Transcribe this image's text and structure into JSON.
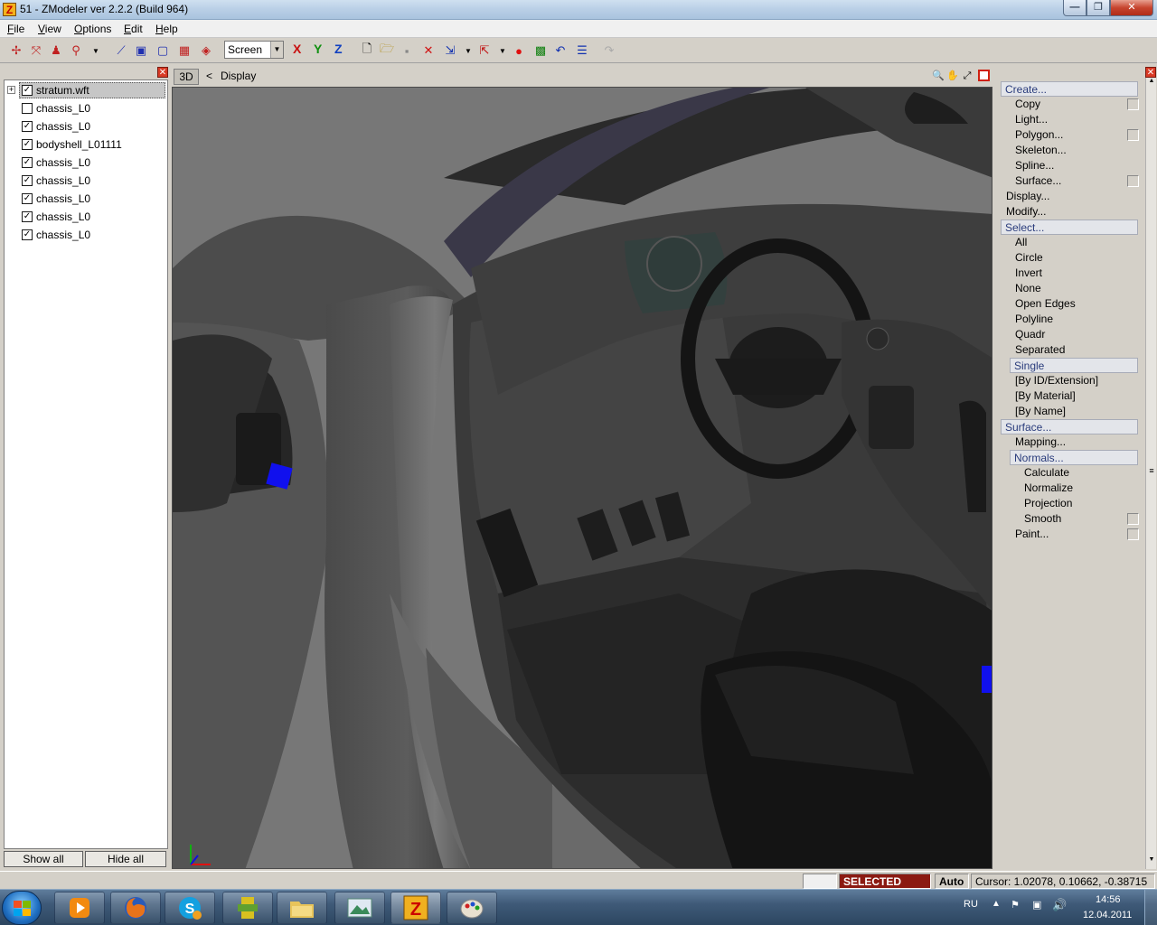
{
  "window": {
    "title": "51 - ZModeler ver 2.2.2 (Build 964)",
    "icon": "Z"
  },
  "menu": [
    {
      "label": "File",
      "key": "F",
      "rest": "ile"
    },
    {
      "label": "View",
      "key": "V",
      "rest": "iew"
    },
    {
      "label": "Options",
      "key": "O",
      "rest": "ptions"
    },
    {
      "label": "Edit",
      "key": "E",
      "rest": "dit"
    },
    {
      "label": "Help",
      "key": "H",
      "rest": "elp"
    }
  ],
  "toolbar": {
    "coord_mode": "Screen",
    "axes": [
      "X",
      "Y",
      "Z"
    ],
    "axis_colors": [
      "#c81010",
      "#109010",
      "#1040c0"
    ]
  },
  "tree": {
    "items": [
      {
        "label": "stratum.wft",
        "checked": "✓",
        "expandable": "+"
      },
      {
        "label": "chassis_L0",
        "checked": ""
      },
      {
        "label": "chassis_L0",
        "checked": "✓"
      },
      {
        "label": "bodyshell_L01111",
        "checked": "✓"
      },
      {
        "label": "chassis_L0",
        "checked": "✓"
      },
      {
        "label": "chassis_L0",
        "checked": "✓"
      },
      {
        "label": "chassis_L0",
        "checked": "✓"
      },
      {
        "label": "chassis_L0",
        "checked": "✓"
      },
      {
        "label": "chassis_L0",
        "checked": "✓"
      }
    ],
    "show_all": "Show all",
    "hide_all": "Hide all"
  },
  "viewport": {
    "mode": "3D",
    "back": "<",
    "title": "Display"
  },
  "commands": {
    "items": [
      {
        "label": "Create...",
        "level": 0,
        "hl": true
      },
      {
        "label": "Copy",
        "level": 1,
        "check": true
      },
      {
        "label": "Light...",
        "level": 1
      },
      {
        "label": "Polygon...",
        "level": 1,
        "check": true
      },
      {
        "label": "Skeleton...",
        "level": 1
      },
      {
        "label": "Spline...",
        "level": 1
      },
      {
        "label": "Surface...",
        "level": 1,
        "check": true
      },
      {
        "label": "Display...",
        "level": 0
      },
      {
        "label": "Modify...",
        "level": 0
      },
      {
        "label": "Select...",
        "level": 0,
        "hl": true
      },
      {
        "label": "All",
        "level": 1
      },
      {
        "label": "Circle",
        "level": 1
      },
      {
        "label": "Invert",
        "level": 1
      },
      {
        "label": "None",
        "level": 1
      },
      {
        "label": "Open Edges",
        "level": 1
      },
      {
        "label": "Polyline",
        "level": 1
      },
      {
        "label": "Quadr",
        "level": 1
      },
      {
        "label": "Separated",
        "level": 1
      },
      {
        "label": "Single",
        "level": 1,
        "hl": true
      },
      {
        "label": "[By ID/Extension]",
        "level": 1
      },
      {
        "label": "[By Material]",
        "level": 1
      },
      {
        "label": "[By Name]",
        "level": 1
      },
      {
        "label": "Surface...",
        "level": 0,
        "hl": true
      },
      {
        "label": "Mapping...",
        "level": 1
      },
      {
        "label": "Normals...",
        "level": 1,
        "hl": true
      },
      {
        "label": "Calculate",
        "level": 2
      },
      {
        "label": "Normalize",
        "level": 2
      },
      {
        "label": "Projection",
        "level": 2
      },
      {
        "label": "Smooth",
        "level": 2,
        "check": true
      },
      {
        "label": "Paint...",
        "level": 1,
        "check": true
      }
    ]
  },
  "status": {
    "mode": "SELECTED MODE",
    "auto": "Auto",
    "cursor": "Cursor: 1.02078, 0.10662, -0.38715"
  },
  "taskbar": {
    "language": "RU",
    "time": "14:56",
    "date": "12.04.2011",
    "apps": [
      "media-player-icon",
      "firefox-icon",
      "skype-icon",
      "game-icon",
      "folder-icon",
      "image-viewer-icon",
      "zmodeler-icon",
      "paint-icon"
    ]
  }
}
